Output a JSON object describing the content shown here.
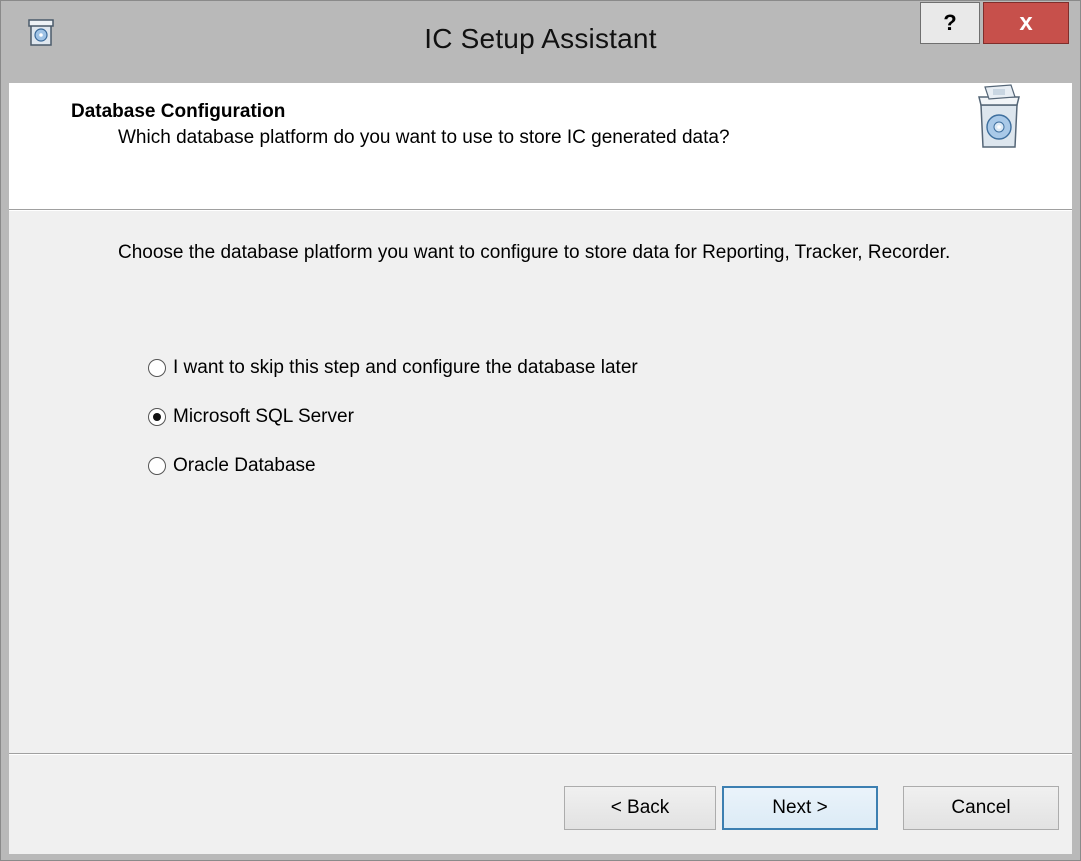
{
  "window": {
    "title": "IC Setup Assistant",
    "help_label": "?",
    "close_label": "x",
    "app_icon": "setup-box-icon"
  },
  "header": {
    "title": "Database Configuration",
    "subtitle": "Which database platform do you want to use to store IC generated data?",
    "icon": "software-box-cd-icon"
  },
  "instructions": "Choose the database platform you want to configure to store data for Reporting, Tracker, Recorder.",
  "options": [
    {
      "label": "I want to skip this step and configure the database later",
      "selected": false
    },
    {
      "label": "Microsoft SQL Server",
      "selected": true
    },
    {
      "label": "Oracle Database",
      "selected": false
    }
  ],
  "buttons": {
    "back": "< Back",
    "next": "Next >",
    "cancel": "Cancel"
  },
  "colors": {
    "close_button": "#c7504b",
    "title_bar": "#b9b9b9",
    "default_button_border": "#3c7fb1"
  }
}
